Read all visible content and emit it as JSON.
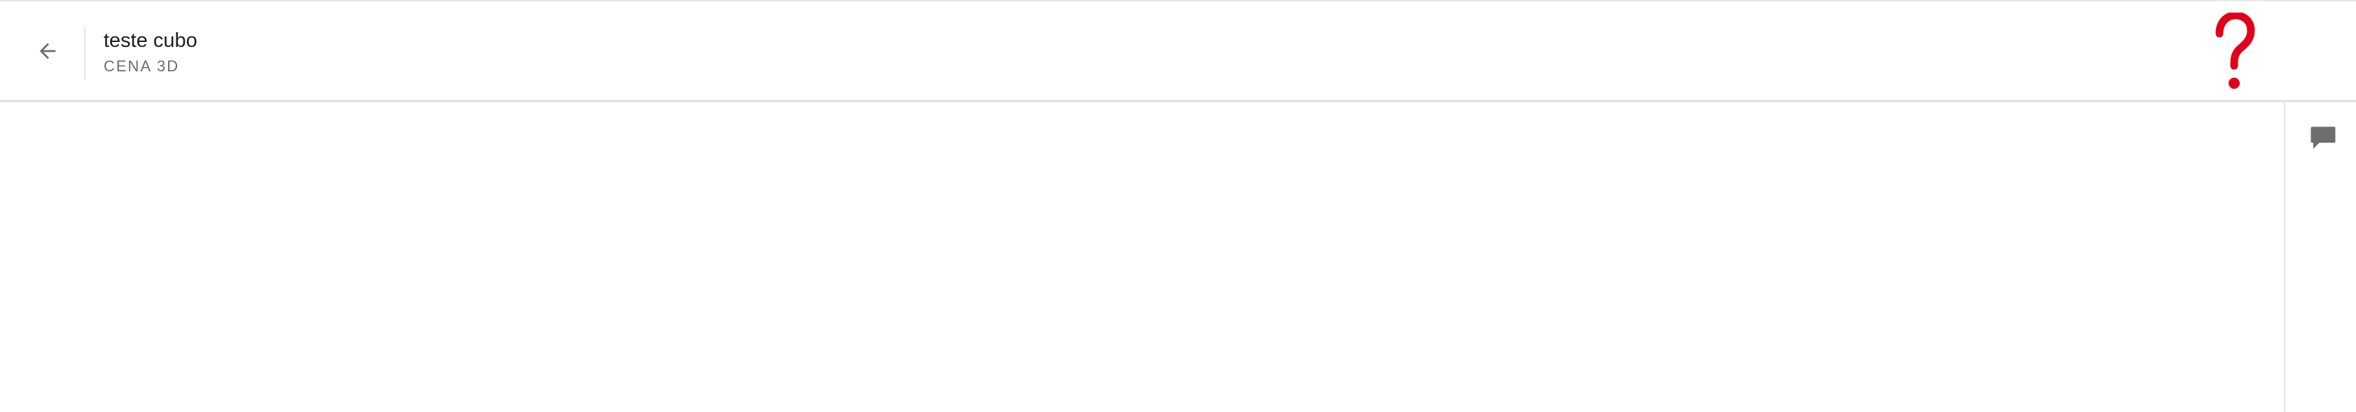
{
  "header": {
    "title": "teste cubo",
    "subtitle": "CENA 3D",
    "back_icon": "arrow-left-icon",
    "help_icon": "question-mark-icon",
    "help_color": "#e1001a"
  },
  "right_rail": {
    "comment_icon": "comment-bubble-icon"
  },
  "colors": {
    "icon_gray": "#6e6e6e",
    "border": "#e1e1e1",
    "background": "#ffffff"
  }
}
